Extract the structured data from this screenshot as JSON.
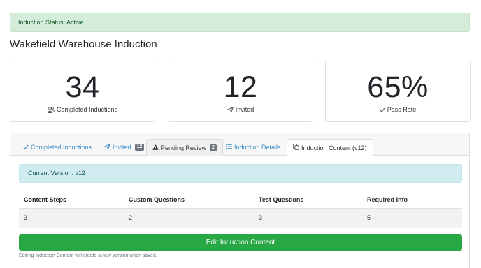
{
  "status_alert": "Induction Status: Active",
  "page_title": "Wakefield Warehouse Induction",
  "stats": [
    {
      "value": "34",
      "label": "Completed Inductions",
      "icon": "users-icon"
    },
    {
      "value": "12",
      "label": "Invited",
      "icon": "send-icon"
    },
    {
      "value": "65%",
      "label": "Pass Rate",
      "icon": "check-icon"
    }
  ],
  "tabs": [
    {
      "label": "Completed Inductions",
      "icon": "check-icon"
    },
    {
      "label": "Invited",
      "icon": "send-icon",
      "badge": "12"
    },
    {
      "label": "Pending Review",
      "icon": "warning-icon",
      "badge": "2"
    },
    {
      "label": "Induction Details",
      "icon": "list-icon"
    },
    {
      "label": "Induction Content (v12)",
      "icon": "copy-icon",
      "active": true
    }
  ],
  "version_alert": "Current Version: v12",
  "table": {
    "headers": [
      "Content Steps",
      "Custom Questions",
      "Test Questions",
      "Required Info"
    ],
    "row": [
      "3",
      "2",
      "3",
      "5"
    ]
  },
  "edit_button": "Edit Induction Content",
  "help_text": "Editing Induction Content will create a new version when saved.",
  "colors": {
    "success": "#28a745",
    "success_bg": "#d4edda",
    "info_bg": "#d1ecf1",
    "link": "#3a8fc9",
    "badge": "#6c757d"
  }
}
